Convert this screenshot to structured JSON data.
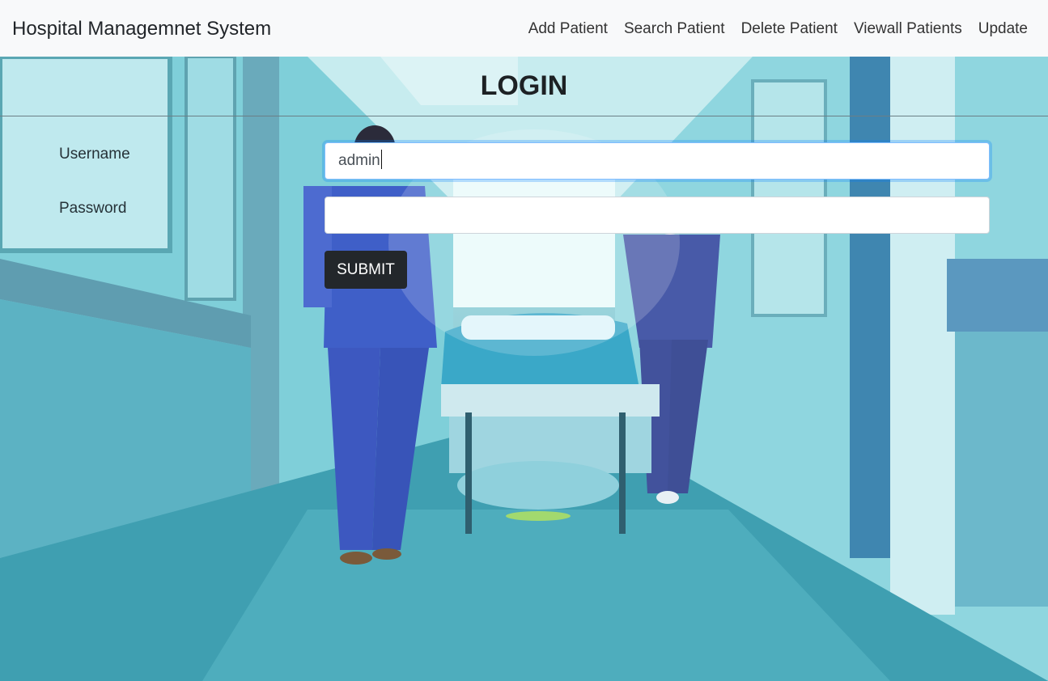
{
  "navbar": {
    "brand": "Hospital Managemnet System",
    "links": [
      "Add Patient",
      "Search Patient",
      "Delete Patient",
      "Viewall Patients",
      "Update"
    ]
  },
  "login": {
    "title": "LOGIN",
    "username_label": "Username",
    "username_value": "admin",
    "password_label": "Password",
    "password_value": "",
    "submit_label": "SUBMIT"
  },
  "colors": {
    "navbar_bg": "#f8f9fa",
    "button_bg": "#23272b",
    "focus_border": "#80bdff"
  },
  "background": {
    "image": "hospital-corridor-photo"
  }
}
